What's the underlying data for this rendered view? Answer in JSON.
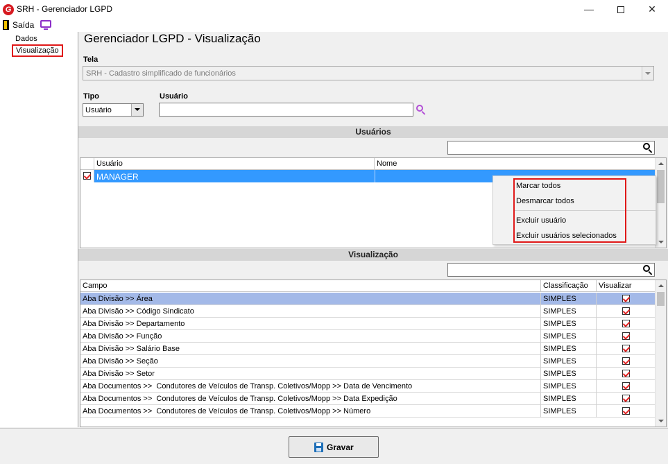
{
  "window": {
    "title": "SRH - Gerenciador LGPD",
    "logo_letter": "G",
    "minimize_glyph": "—",
    "close_glyph": "✕"
  },
  "menu": {
    "exit_label": "Saída"
  },
  "nav": {
    "items": [
      {
        "label": "Dados"
      },
      {
        "label": "Visualização"
      }
    ]
  },
  "page": {
    "title": "Gerenciador LGPD - Visualização"
  },
  "tela": {
    "label": "Tela",
    "value": "SRH - Cadastro simplificado de funcionários"
  },
  "tipo": {
    "label": "Tipo",
    "value": "Usuário"
  },
  "usuario": {
    "label": "Usuário",
    "value": ""
  },
  "usuarios_section": {
    "header": "Usuários",
    "columns": [
      "Usuário",
      "Nome"
    ],
    "rows": [
      {
        "checked": true,
        "usuario": "MANAGER",
        "nome": ""
      }
    ]
  },
  "context_menu": {
    "items": [
      "Marcar todos",
      "Desmarcar todos",
      "Excluir usuário",
      "Excluir usuários selecionados"
    ]
  },
  "visualizacao_section": {
    "header": "Visualização",
    "columns": [
      "Campo",
      "Classificação",
      "Visualizar"
    ],
    "rows": [
      {
        "campo": "Aba Divisão >> Área",
        "classificacao": "SIMPLES",
        "visualizar": true
      },
      {
        "campo": "Aba Divisão >> Código Sindicato",
        "classificacao": "SIMPLES",
        "visualizar": true
      },
      {
        "campo": "Aba Divisão >> Departamento",
        "classificacao": "SIMPLES",
        "visualizar": true
      },
      {
        "campo": "Aba Divisão >> Função",
        "classificacao": "SIMPLES",
        "visualizar": true
      },
      {
        "campo": "Aba Divisão >> Salário Base",
        "classificacao": "SIMPLES",
        "visualizar": true
      },
      {
        "campo": "Aba Divisão >> Seção",
        "classificacao": "SIMPLES",
        "visualizar": true
      },
      {
        "campo": "Aba Divisão >> Setor",
        "classificacao": "SIMPLES",
        "visualizar": true
      },
      {
        "campo": "Aba Documentos >>  Condutores de Veículos de Transp. Coletivos/Mopp >> Data de Vencimento",
        "classificacao": "SIMPLES",
        "visualizar": true
      },
      {
        "campo": "Aba Documentos >>  Condutores de Veículos de Transp. Coletivos/Mopp >> Data Expedição",
        "classificacao": "SIMPLES",
        "visualizar": true
      },
      {
        "campo": "Aba Documentos >>  Condutores de Veículos de Transp. Coletivos/Mopp >> Número",
        "classificacao": "SIMPLES",
        "visualizar": true
      }
    ]
  },
  "actions": {
    "save_label": "Gravar"
  },
  "colors": {
    "selection": "#3399ff",
    "row_highlight": "#a3b9e8",
    "annotation": "#e01818",
    "accent_purple": "#b24fd6"
  },
  "icons": [
    "app-logo-icon",
    "exit-door-icon",
    "monitor-icon",
    "search-icon",
    "save-disk-icon"
  ]
}
